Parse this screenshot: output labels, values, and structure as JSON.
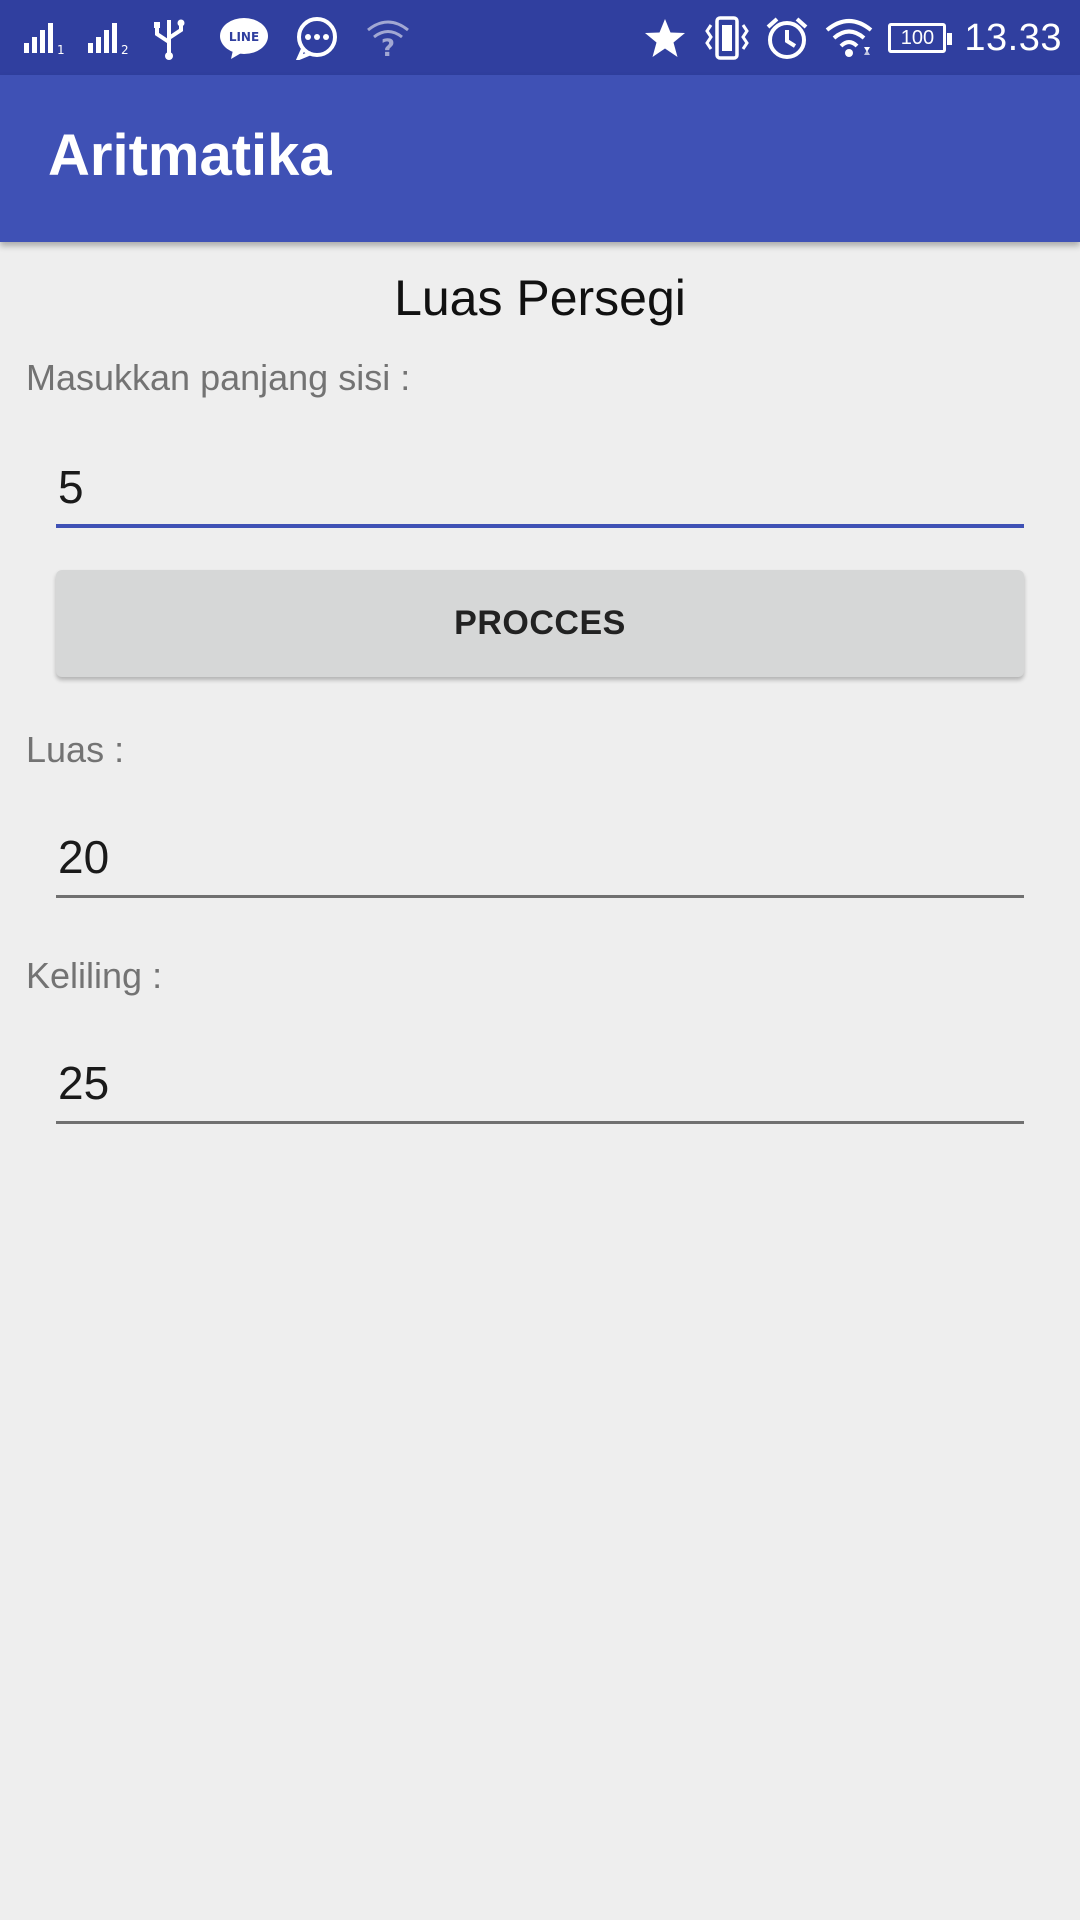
{
  "status_bar": {
    "time": "13.33",
    "battery_level": "100",
    "left_icons": [
      "signal-sim1-icon",
      "signal-sim2-icon",
      "usb-icon",
      "line-app-icon",
      "chat-bubble-icon",
      "wifi-unknown-icon"
    ],
    "right_icons": [
      "star-icon",
      "vibrate-icon",
      "alarm-icon",
      "wifi-icon",
      "battery-icon"
    ]
  },
  "app_bar": {
    "title": "Aritmatika"
  },
  "main": {
    "heading": "Luas Persegi",
    "side_label": "Masukkan panjang sisi :",
    "side_value": "5",
    "process_label": "PROCCES",
    "area_label": "Luas :",
    "area_value": "20",
    "perimeter_label": "Keliling :",
    "perimeter_value": "25"
  },
  "colors": {
    "status_bar": "#303f9f",
    "app_bar": "#3f51b5",
    "background": "#eeeeee",
    "accent": "#3f51b5"
  }
}
